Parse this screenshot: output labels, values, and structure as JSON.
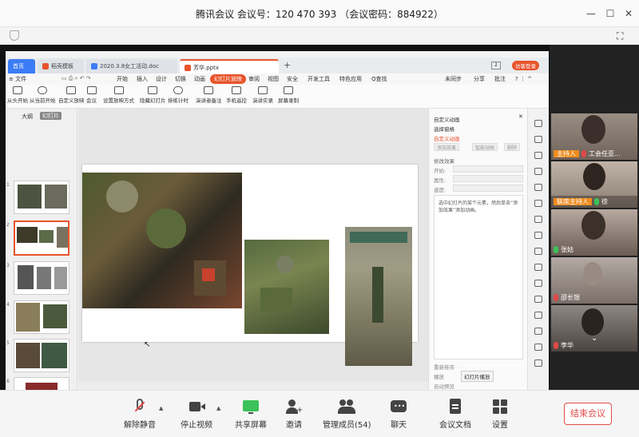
{
  "meeting": {
    "title": "腾讯会议  会议号：120 470 393  （会议密码：884922）"
  },
  "wps": {
    "tabs": [
      {
        "label": "首页"
      },
      {
        "label": "稻壳模板"
      },
      {
        "label": "2020.3.8女工活动.doc"
      },
      {
        "label": "芳华.pptx"
      }
    ],
    "tab_counter": "2",
    "login_label": "访客登录",
    "menu": {
      "file": "≡ 文件",
      "items": [
        "开始",
        "插入",
        "设计",
        "切换",
        "动画",
        "幻灯片放映",
        "审阅",
        "视图",
        "安全",
        "开发工具",
        "特色应用"
      ],
      "search": "Q查找",
      "sync": "未同步",
      "share": "分享",
      "comment": "批注"
    },
    "ribbon": [
      "从头开始",
      "从当前开始",
      "自定义放映",
      "会议",
      "设置放映方式",
      "隐藏幻灯片",
      "排练计时",
      "演讲者备注",
      "手机遥控",
      "演讲实录",
      "屏幕录制"
    ],
    "thumb_tabs": [
      "大纲",
      "幻灯片"
    ],
    "thumb_numbers": [
      "1",
      "2",
      "3",
      "4",
      "5",
      "6",
      "7"
    ],
    "anim_pane": {
      "title": "自定义动画",
      "select_pane": "选择窗格",
      "custom_anim": "自定义动画",
      "add_effect": "添加效果",
      "smart_anim": "智能动画",
      "delete": "删除",
      "modify": "修改效果",
      "start": "开始:",
      "property": "属性:",
      "speed": "速度:",
      "hint": "选中幻灯片的某个元素，然后单击“添加效果”添加动画。",
      "reorder": "重新排序",
      "play": "播放",
      "slideshow": "幻灯片播放",
      "autopreview": "自动预览"
    }
  },
  "participants": [
    {
      "role": "主持人",
      "name": "工会任亚...",
      "mic": "off"
    },
    {
      "role": "联席主持人",
      "name": "徐",
      "mic": "on"
    },
    {
      "role": "",
      "name": "张姑",
      "mic": "on"
    },
    {
      "role": "",
      "name": "邵长银",
      "mic": "off"
    },
    {
      "role": "",
      "name": "李华",
      "mic": "off"
    }
  ],
  "toolbar": {
    "mute": "解除静音",
    "video": "停止视频",
    "share": "共享屏幕",
    "invite": "邀请",
    "members": "管理成员(54)",
    "chat": "聊天",
    "docs": "会议文档",
    "settings": "设置",
    "end": "结束会议"
  },
  "colors": {
    "accent": "#e8542c",
    "tencent_green": "#3cc25a",
    "end_red": "#e24c4c",
    "host_orange": "#f08c1e"
  }
}
